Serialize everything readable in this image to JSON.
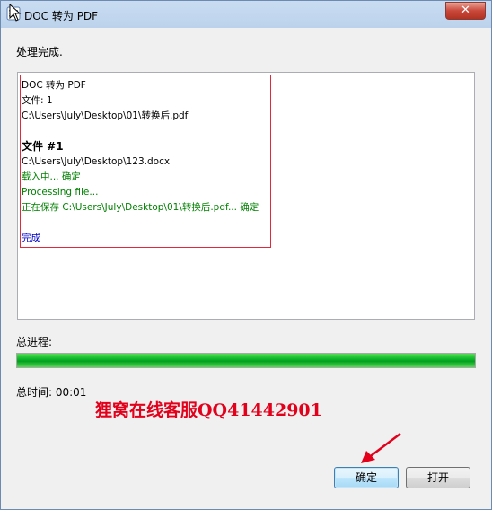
{
  "window": {
    "title": "DOC 转为 PDF",
    "close_label": "✕"
  },
  "status": "处理完成.",
  "log": {
    "lines": [
      {
        "text": "DOC 转为 PDF",
        "style": "normal"
      },
      {
        "text": "文件: 1",
        "style": "normal"
      },
      {
        "text": "C:\\Users\\July\\Desktop\\01\\转换后.pdf",
        "style": "normal"
      },
      {
        "text": "",
        "style": "normal"
      },
      {
        "text": "文件 #1",
        "style": "bold"
      },
      {
        "text": "C:\\Users\\July\\Desktop\\123.docx",
        "style": "normal"
      },
      {
        "text": "载入中... 确定",
        "style": "green"
      },
      {
        "text": "Processing file...",
        "style": "green"
      },
      {
        "text": "正在保存 C:\\Users\\July\\Desktop\\01\\转换后.pdf... 确定",
        "style": "green"
      },
      {
        "text": "",
        "style": "normal"
      },
      {
        "text": "完成",
        "style": "blue"
      }
    ]
  },
  "progress": {
    "label": "总进程:",
    "percent": 100
  },
  "time": {
    "label": "总时间: 00:01"
  },
  "watermark": "狸窝在线客服QQ41442901",
  "buttons": {
    "ok": "确定",
    "open": "打开"
  },
  "colors": {
    "progress": "#06b025",
    "annotation": "#e0293a",
    "log_green": "#008000",
    "log_blue": "#0000cc"
  },
  "icons": [
    "app-icon",
    "close-icon",
    "annotation-arrow-icon",
    "mouse-cursor-icon"
  ]
}
